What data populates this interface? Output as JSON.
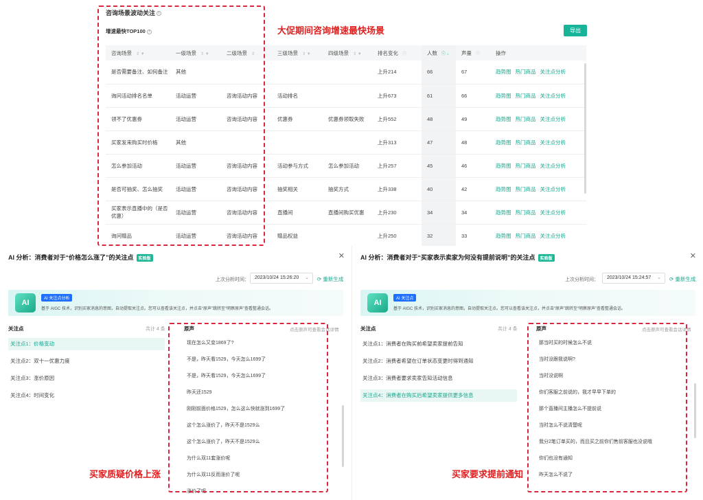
{
  "top": {
    "title": "咨询场景波动关注",
    "subtitle": "增速最快TOP100",
    "export_label": "导出",
    "annotation": "大促期间咨询增速最快场景",
    "columns": [
      "咨询场景",
      "一级场景",
      "二级场景",
      "三级场景",
      "四级场景",
      "排名变化",
      "人数",
      "声量",
      "操作"
    ],
    "actions": [
      "趋势图",
      "热门商品",
      "关注点分析"
    ],
    "rows": [
      {
        "scene": "是否需要备注、如何备注",
        "l1": "其他",
        "l2": "",
        "l3": "",
        "l4": "",
        "rank": "上升214",
        "people": "66",
        "volume": "67"
      },
      {
        "scene": "询问活动排名名单",
        "l1": "活动运营",
        "l2": "咨询活动内容",
        "l3": "活动排名",
        "l4": "",
        "rank": "上升673",
        "people": "61",
        "volume": "66"
      },
      {
        "scene": "领不了优惠券",
        "l1": "活动运营",
        "l2": "咨询活动内容",
        "l3": "优惠券",
        "l4": "优惠券领取失败",
        "rank": "上升552",
        "people": "48",
        "volume": "49"
      },
      {
        "scene": "买家发来购买时价格",
        "l1": "其他",
        "l2": "",
        "l3": "",
        "l4": "",
        "rank": "上升313",
        "people": "47",
        "volume": "48"
      },
      {
        "scene": "怎么参加活动",
        "l1": "活动运营",
        "l2": "咨询活动内容",
        "l3": "活动参与方式",
        "l4": "怎么参加活动",
        "rank": "上升257",
        "people": "45",
        "volume": "46"
      },
      {
        "scene": "是否可抽奖、怎么抽奖",
        "l1": "活动运营",
        "l2": "咨询活动内容",
        "l3": "抽奖相关",
        "l4": "抽奖方式",
        "rank": "上升338",
        "people": "40",
        "volume": "42"
      },
      {
        "scene": "买家表示直播中的（是否优惠）",
        "l1": "活动运营",
        "l2": "咨询活动内容",
        "l3": "直播间",
        "l4": "直播间购买优惠",
        "rank": "上升230",
        "people": "34",
        "volume": "34"
      },
      {
        "scene": "询问赠品",
        "l1": "活动运营",
        "l2": "咨询活动内容",
        "l3": "赠品权益",
        "l4": "",
        "rank": "上升250",
        "people": "32",
        "volume": "33"
      }
    ]
  },
  "left_ai": {
    "title": "AI 分析：消费者对于“价格怎么涨了”的关注点",
    "tag": "实验版",
    "last_time_label": "上次分析时间：",
    "time_value": "2023/10/24 15:26:20",
    "regen": "重新生成",
    "banner_tag": "AI 关注点分析",
    "banner_text": "基于 AIGC 技术，识别买家消息的意图，自动提取关注点。您可以查看该关注点，并点击“原声”跳转至“明察原声”查看整通会话。",
    "focus_label": "关注点",
    "count": "共计 4 条",
    "voice_label": "原声",
    "hint": "点击原声可查看会话详情",
    "annotation": "买家质疑价格上涨",
    "focus_points": [
      "关注点1：价格变动",
      "关注点2：双十一优惠力度",
      "关注点3：涨价原因",
      "关注点4：时间变化"
    ],
    "voices": [
      "现在怎么又变1869了?",
      "不是，昨天看1529，今天怎么1699了",
      "不是，昨天看1529，今天怎么1699了",
      "昨天还1529",
      "刚刚前面价格1529，怎么这么快就涨到1699了",
      "这个怎么涨价了，昨天不是1529么",
      "这个怎么涨价了，昨天不是1529么",
      "为什么双11套涨价呢",
      "为什么双11反而涨价了呢",
      "涨价了呢"
    ]
  },
  "right_ai": {
    "title": "AI 分析：消费者对于“买家表示卖家为何没有提前说明”的关注点",
    "tag": "实验版",
    "last_time_label": "上次分析时间：",
    "time_value": "2023/10/24 15:24:57",
    "regen": "重新生成",
    "banner_tag": "AI 关注点",
    "banner_text": "基于 AIGC 技术，识别买家消息的意图，自动提取关注点。您可以查看该关注点，并点击“原声”跳转至“明察原声”查看整通会话。",
    "focus_label": "关注点",
    "count": "共计 4 条",
    "voice_label": "原声",
    "hint": "点击原声可查看会话详情",
    "annotation": "买家要求提前通知",
    "focus_points": [
      "关注点1：消费者在购买前希望卖家提前告知",
      "关注点2：消费者希望在订单状态变更时得到通知",
      "关注点3：消费者要求卖家告知活动信息",
      "关注点4：消费者在购买后希望卖家提供更多信息"
    ],
    "voices": [
      "那当时买的时候怎么不说",
      "当时没跟我说啊?",
      "当时没说啊",
      "你们客服之前说的，我才早早下单的",
      "那个直播间主播怎么不提前说",
      "当时怎么不说清楚呢",
      "我分2笔订单买的，而且买之前你们售前客服也没说哦",
      "你们也没有通知",
      "昨天怎么不说了"
    ]
  }
}
